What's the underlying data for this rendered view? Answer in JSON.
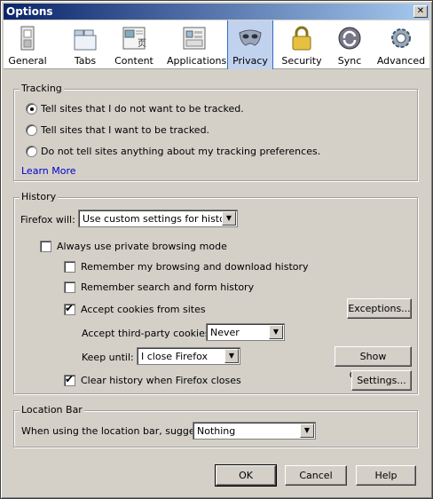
{
  "window": {
    "title": "Options",
    "close_glyph": "✕"
  },
  "toolbar": {
    "items": [
      {
        "label": "General",
        "icon": "general-icon"
      },
      {
        "label": "Tabs",
        "icon": "tabs-icon"
      },
      {
        "label": "Content",
        "icon": "content-icon"
      },
      {
        "label": "Applications",
        "icon": "applications-icon"
      },
      {
        "label": "Privacy",
        "icon": "privacy-icon",
        "selected": true
      },
      {
        "label": "Security",
        "icon": "security-icon"
      },
      {
        "label": "Sync",
        "icon": "sync-icon"
      },
      {
        "label": "Advanced",
        "icon": "advanced-icon"
      }
    ]
  },
  "tracking": {
    "legend": "Tracking",
    "options": [
      {
        "label": "Tell sites that I do not want to be tracked.",
        "selected": true
      },
      {
        "label": "Tell sites that I want to be tracked.",
        "selected": false
      },
      {
        "label": "Do not tell sites anything about my tracking preferences.",
        "selected": false
      }
    ],
    "learn_more": "Learn More"
  },
  "history": {
    "legend": "History",
    "firefox_will_label": "Firefox will:",
    "firefox_will_value": "Use custom settings for history",
    "always_private": {
      "label": "Always use private browsing mode",
      "checked": false
    },
    "remember_browsing": {
      "label": "Remember my browsing and download history",
      "checked": false
    },
    "remember_search": {
      "label": "Remember search and form history",
      "checked": false
    },
    "accept_cookies": {
      "label": "Accept cookies from sites",
      "checked": true
    },
    "exceptions_button": "Exceptions...",
    "third_party_label": "Accept third-party cookies:",
    "third_party_value": "Never",
    "keep_until_label": "Keep until:",
    "keep_until_value": "I close Firefox",
    "show_cookies_button": "Show Cookies...",
    "clear_history": {
      "label": "Clear history when Firefox closes",
      "checked": true
    },
    "settings_button": "Settings..."
  },
  "location_bar": {
    "legend": "Location Bar",
    "suggest_label": "When using the location bar, suggest:",
    "suggest_value": "Nothing"
  },
  "footer": {
    "ok": "OK",
    "cancel": "Cancel",
    "help": "Help"
  },
  "colors": {
    "title_start": "#0a246a",
    "title_end": "#a6caf0",
    "selected_tab": "#c1d2ee",
    "link": "#0000cc"
  }
}
